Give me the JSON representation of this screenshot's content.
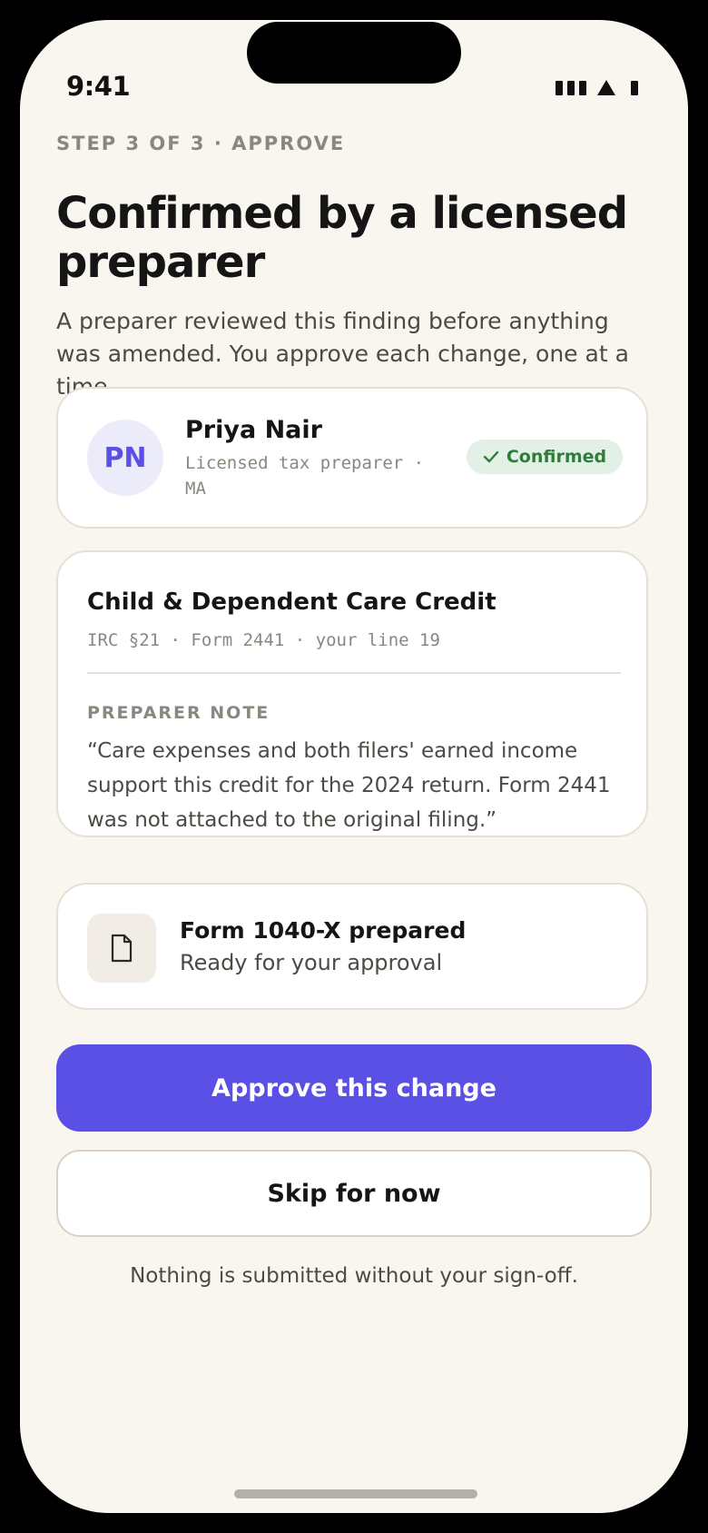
{
  "status_bar": {
    "time": "9:41"
  },
  "step_label": "STEP 3 OF 3 · APPROVE",
  "title": "Confirmed by a licensed preparer",
  "subtitle": "A preparer reviewed this finding before anything was amended. You approve each change, one at a time.",
  "preparer": {
    "initials": "PN",
    "name": "Priya Nair",
    "role": "Licensed tax preparer · MA",
    "badge": "Confirmed"
  },
  "credit": {
    "title": "Child & Dependent Care Credit",
    "reference": "IRC §21 · Form 2441 · your line 19",
    "note_label": "PREPARER NOTE",
    "note": "“Care expenses and both filers' earned income support this credit for the 2024 return. Form 2441 was not attached to the original filing.”"
  },
  "form": {
    "icon": "document-icon",
    "title": "Form 1040-X prepared",
    "subtitle": "Ready for your approval"
  },
  "actions": {
    "approve_label": "Approve this change",
    "skip_label": "Skip for now"
  },
  "footnote": "Nothing is submitted without your sign-off.",
  "colors": {
    "accent": "#5a50e6",
    "background": "#f9f6f0",
    "success": "#2f7d3d",
    "success_bg": "#e3f0e5"
  }
}
